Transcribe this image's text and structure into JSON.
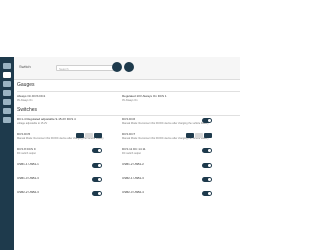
{
  "header": {
    "title": "Switch",
    "search_placeholder": "Search"
  },
  "gauges": {
    "heading": "Gauges",
    "items": [
      {
        "label": "Always On DCS DC1",
        "sub": "0V Always On"
      },
      {
        "label": "Regulated 10V Always On DCS 1",
        "sub": "0V Always On"
      }
    ]
  },
  "switches": {
    "heading": "Switches",
    "items": [
      {
        "label": "DC1-4 Regulated adjustable 9-15.2V DCS 4",
        "sub": "voltage adjustable to 15.2V"
      },
      {
        "label": "DCS DC6",
        "sub": "Manual Mode: Reconnect this DC/DC device after charging the vehicle battery"
      },
      {
        "label": "DCS DC5",
        "sub": "Manual Mode: Reconnect this DC/DC device after charging the vehicle battery"
      },
      {
        "label": "DCS DC7",
        "sub": "Manual Mode: Reconnect this DC/DC device after charging the vehicle battery"
      },
      {
        "label": "DCS 8 DCS 9",
        "sub": "DC switch output"
      },
      {
        "label": "DCS 11 DC 14 11",
        "sub": "DC switch output"
      },
      {
        "label": "USB1-1 USB1-1",
        "sub": ""
      },
      {
        "label": "USB1-2 USB1-2",
        "sub": ""
      },
      {
        "label": "USB1-3 USB1-3",
        "sub": ""
      },
      {
        "label": "USB2-1 USB1-3",
        "sub": ""
      },
      {
        "label": "USB2-2 USB2-3",
        "sub": ""
      },
      {
        "label": "USB2-3 USB2-4",
        "sub": ""
      }
    ]
  },
  "buttons": {
    "on": "ON",
    "off": "OFF",
    "auto": "AUTO"
  }
}
